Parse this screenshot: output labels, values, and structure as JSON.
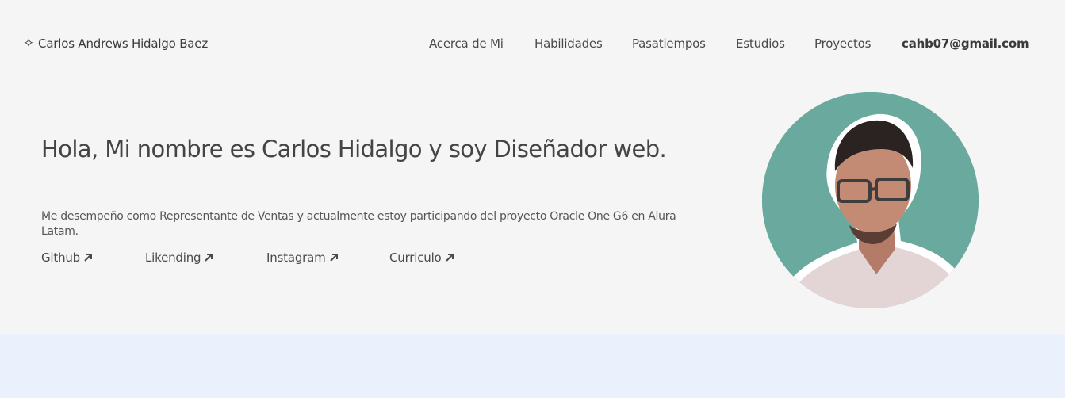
{
  "brand": {
    "icon": "sparkle-icon",
    "name": "Carlos Andrews Hidalgo Baez"
  },
  "nav": {
    "items": [
      "Acerca de Mi",
      "Habilidades",
      "Pasatiempos",
      "Estudios",
      "Proyectos"
    ],
    "email": "cahb07@gmail.com"
  },
  "hero": {
    "title": "Hola, Mi nombre es Carlos Hidalgo y soy Diseñador web.",
    "description": "Me desempeño como Representante de Ventas y actualmente estoy participando del proyecto Oracle One G6 en Alura Latam.",
    "links": [
      {
        "label": "Github",
        "icon": "arrow-up-right-icon"
      },
      {
        "label": "Likending",
        "icon": "arrow-up-right-icon"
      },
      {
        "label": "Instagram",
        "icon": "arrow-up-right-icon"
      },
      {
        "label": "Curriculo",
        "icon": "arrow-up-right-icon"
      }
    ]
  },
  "colors": {
    "background": "#f5f5f5",
    "avatar_bg": "#69a99e",
    "band": "#eaf1fd",
    "text": "#464646"
  }
}
